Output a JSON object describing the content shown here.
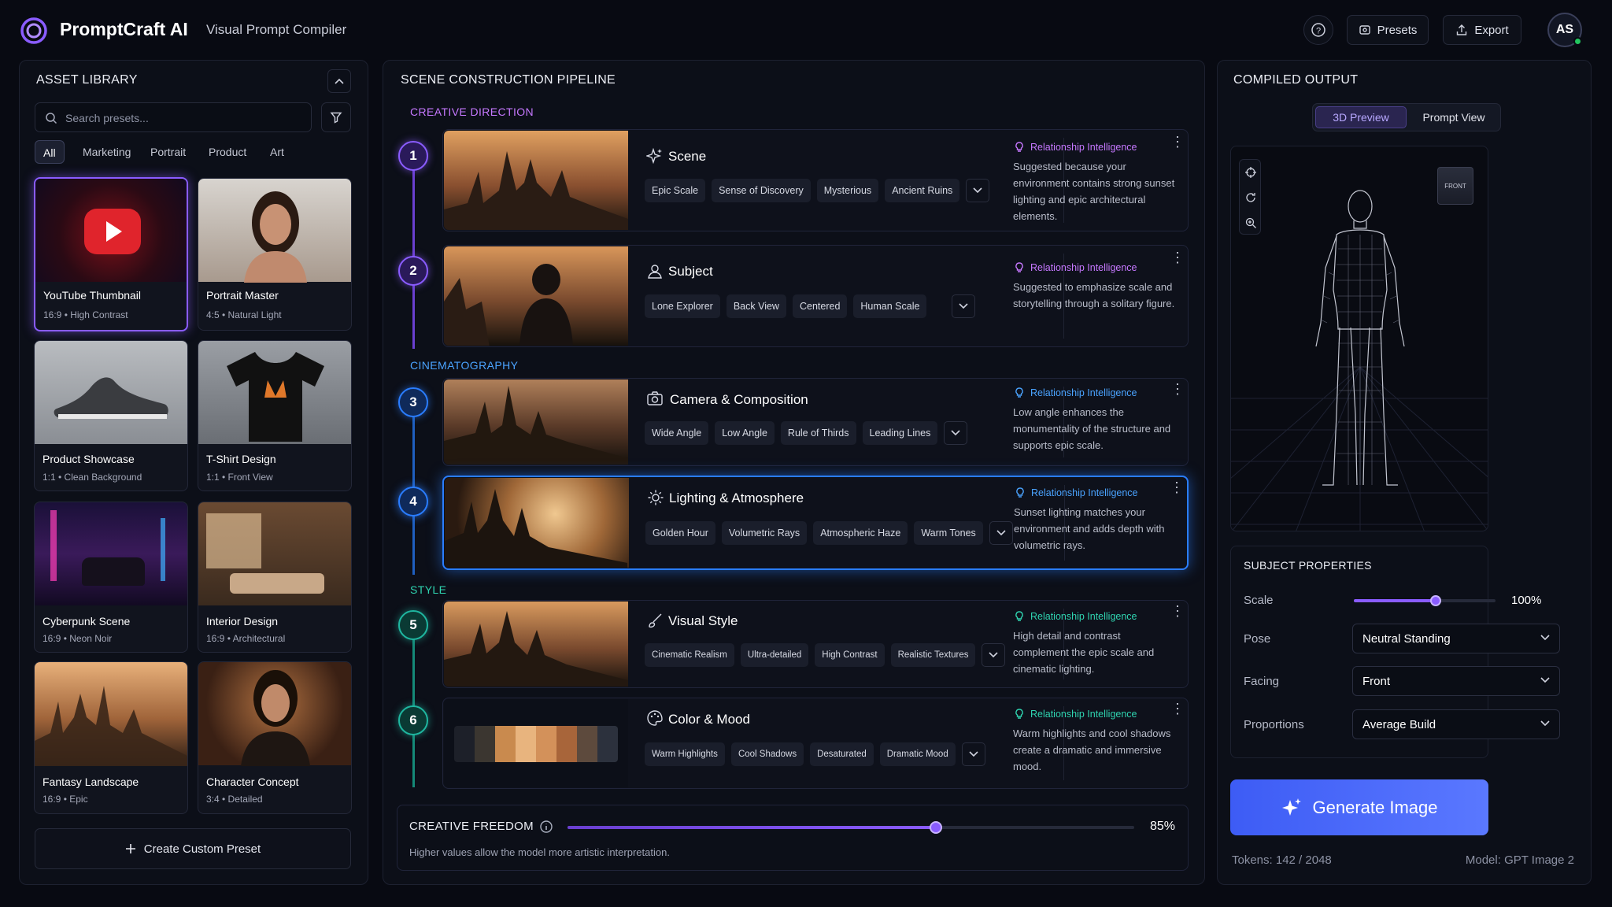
{
  "header": {
    "app_name": "PromptCraft AI",
    "subtitle": "Visual Prompt Compiler",
    "presets_label": "Presets",
    "export_label": "Export",
    "avatar_initials": "AS"
  },
  "library": {
    "title": "ASSET LIBRARY",
    "search_placeholder": "Search presets...",
    "filters": [
      "All",
      "Marketing",
      "Portrait",
      "Product",
      "Art"
    ],
    "active_filter": "All",
    "presets": [
      {
        "name": "YouTube Thumbnail",
        "meta": "16:9  •  High Contrast",
        "selected": true
      },
      {
        "name": "Portrait Master",
        "meta": "4:5  •  Natural Light"
      },
      {
        "name": "Product Showcase",
        "meta": "1:1  •  Clean Background"
      },
      {
        "name": "T-Shirt Design",
        "meta": "1:1  •  Front View"
      },
      {
        "name": "Cyberpunk Scene",
        "meta": "16:9  •  Neon Noir"
      },
      {
        "name": "Interior Design",
        "meta": "16:9  •  Architectural"
      },
      {
        "name": "Fantasy Landscape",
        "meta": "16:9  •  Epic"
      },
      {
        "name": "Character Concept",
        "meta": "3:4  •  Detailed"
      }
    ],
    "create_label": "Create Custom Preset"
  },
  "pipeline": {
    "title": "SCENE CONSTRUCTION PIPELINE",
    "sections": {
      "creative": "CREATIVE DIRECTION",
      "cinema": "CINEMATOGRAPHY",
      "style": "STYLE"
    },
    "ri_label": "Relationship Intelligence",
    "steps": [
      {
        "num": "1",
        "title": "Scene",
        "icon": "sparkle-icon",
        "tags": [
          "Epic Scale",
          "Sense of Discovery",
          "Mysterious",
          "Ancient Ruins"
        ],
        "desc": "Suggested because your environment contains strong sunset lighting and epic architectural elements."
      },
      {
        "num": "2",
        "title": "Subject",
        "icon": "user-icon",
        "tags": [
          "Lone Explorer",
          "Back View",
          "Centered",
          "Human Scale"
        ],
        "desc": "Suggested to emphasize scale and storytelling through a solitary figure."
      },
      {
        "num": "3",
        "title": "Camera & Composition",
        "icon": "camera-icon",
        "tags": [
          "Wide Angle",
          "Low Angle",
          "Rule of Thirds",
          "Leading Lines"
        ],
        "desc": "Low angle enhances the monumentality of the structure and supports epic scale."
      },
      {
        "num": "4",
        "title": "Lighting & Atmosphere",
        "icon": "sun-icon",
        "tags": [
          "Golden Hour",
          "Volumetric Rays",
          "Atmospheric Haze",
          "Warm Tones"
        ],
        "desc": "Sunset lighting matches your environment and adds depth with volumetric rays."
      },
      {
        "num": "5",
        "title": "Visual Style",
        "icon": "brush-icon",
        "tags": [
          "Cinematic Realism",
          "Ultra-detailed",
          "High Contrast",
          "Realistic Textures"
        ],
        "desc": "High detail and contrast complement the epic scale and cinematic lighting."
      },
      {
        "num": "6",
        "title": "Color & Mood",
        "icon": "palette-icon",
        "tags": [
          "Warm Highlights",
          "Cool Shadows",
          "Desaturated",
          "Dramatic Mood"
        ],
        "desc": "Warm highlights and cool shadows create a dramatic and immersive mood."
      }
    ],
    "palette": [
      "#1d2029",
      "#3b3630",
      "#c98a4e",
      "#e8b47e",
      "#d3915a",
      "#a8653a",
      "#5d4a3d",
      "#2c313d"
    ],
    "freedom": {
      "label": "CREATIVE FREEDOM",
      "value_text": "85%",
      "value": 0.65,
      "hint": "Higher values allow the model more artistic interpretation."
    }
  },
  "output": {
    "title": "COMPILED OUTPUT",
    "tab_3d": "3D Preview",
    "tab_prompt": "Prompt View",
    "cube_label": "FRONT",
    "props_title": "SUBJECT PROPERTIES",
    "scale_label": "Scale",
    "scale_value_text": "100%",
    "pose_label": "Pose",
    "pose_value": "Neutral Standing",
    "facing_label": "Facing",
    "facing_value": "Front",
    "proportions_label": "Proportions",
    "proportions_value": "Average Build",
    "generate_label": "Generate Image",
    "tokens": "Tokens: 142 / 2048",
    "model": "Model: GPT Image 2"
  },
  "colors": {
    "accent": "#8a5cff",
    "blue": "#2a7dff",
    "teal": "#1fb6a0",
    "ri_purple": "#c678ff",
    "ri_blue": "#4aa3ff",
    "ri_teal": "#2fd4b0"
  }
}
